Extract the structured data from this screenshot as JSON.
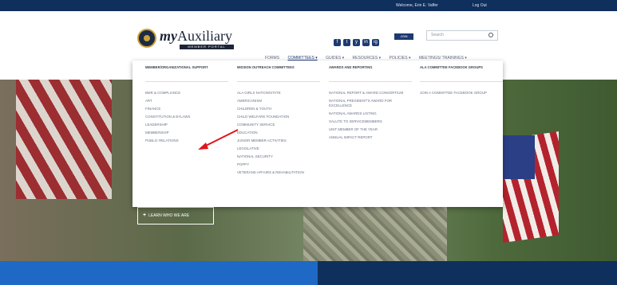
{
  "topbar": {
    "welcome": "Welcome, Erin E. Vaffer",
    "logout": "Log Out"
  },
  "brand": {
    "logo_word_my": "my",
    "logo_word_aux": "Auxiliary",
    "logo_sub": "MEMBER PORTAL"
  },
  "header": {
    "social": [
      "f",
      "t",
      "y",
      "in",
      "ig"
    ],
    "join_label": "JOIN",
    "search_placeholder": "Search"
  },
  "nav": {
    "items": [
      "FORMS",
      "COMMITTEES ▾",
      "GUIDES ▾",
      "RESOURCES ▾",
      "POLICIES ▾",
      "MEETINGS/ TRAININGS ▾"
    ]
  },
  "dropdown": {
    "columns": [
      {
        "heading": "MEMBER/ORGANIZATIONAL SUPPORT",
        "items": [
          "BMR & COMPLIANCE",
          "ART",
          "FINANCE",
          "CONSTITUTION & BYLAWS",
          "LEADERSHIP",
          "MEMBERSHIP",
          "PUBLIC RELATIONS"
        ]
      },
      {
        "heading": "MISSION OUTREACH COMMITTEES",
        "items": [
          "ALA GIRLS NATION/STATE",
          "AMERICANISM",
          "CHILDREN & YOUTH",
          "CHILD WELFARE FOUNDATION",
          "COMMUNITY SERVICE",
          "EDUCATION",
          "JUNIOR MEMBER ACTIVITIES",
          "LEGISLATIVE",
          "NATIONAL SECURITY",
          "POPPY",
          "VETERANS AFFAIRS & REHABILITATION"
        ]
      },
      {
        "heading": "AWARDS AND REPORTING",
        "items": [
          "NATIONAL REPORT & AWARD CONSORTIUM",
          "NATIONAL PRESIDENT'S AWARD FOR EXCELLENCE",
          "NATIONAL AWARDS LISTING",
          "SALUTE TO SERVICEMEMBERS",
          "UNIT MEMBER OF THE YEAR",
          "ANNUAL IMPACT REPORT"
        ]
      },
      {
        "heading": "ALA COMMITTEE FACEBOOK GROUPS",
        "items": [
          "JOIN A COMMITTEE FACEBOOK GROUP"
        ]
      }
    ]
  },
  "hero": {
    "cta_label": "LEARN WHO WE ARE"
  },
  "colors": {
    "navy": "#0f2f5c",
    "blue": "#1e69c5",
    "accent_red": "#e0151c"
  }
}
